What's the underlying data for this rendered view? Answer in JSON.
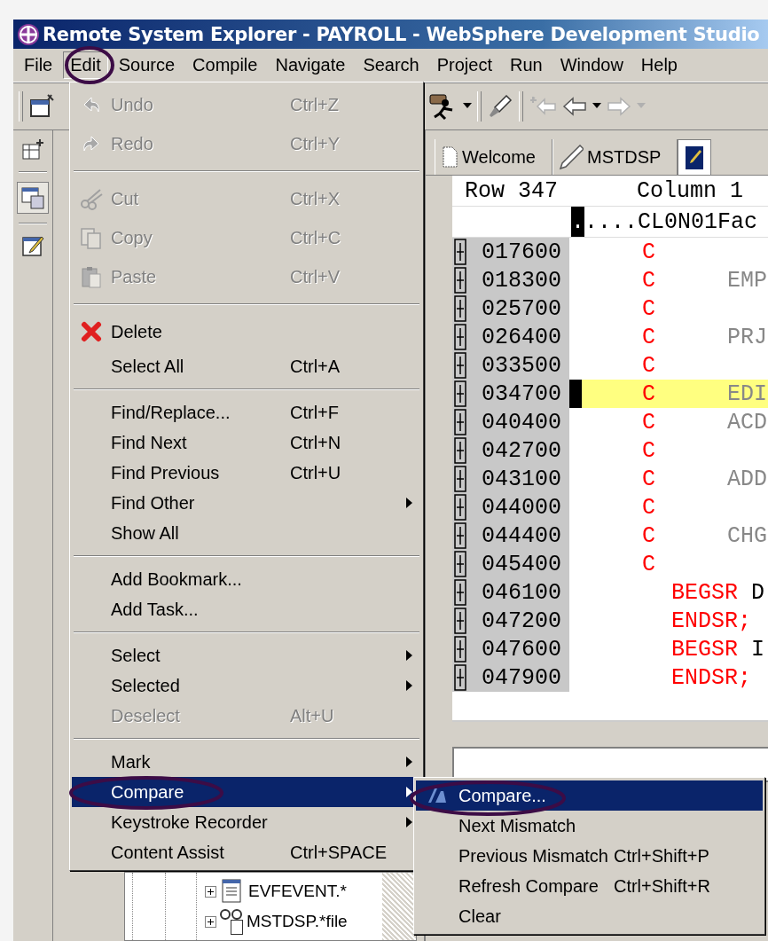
{
  "window": {
    "title": "Remote System Explorer - PAYROLL - WebSphere Development Studio"
  },
  "menu_bar": [
    {
      "label": "File",
      "selected": false
    },
    {
      "label": "Edit",
      "selected": true
    },
    {
      "label": "Source",
      "selected": false
    },
    {
      "label": "Compile",
      "selected": false
    },
    {
      "label": "Navigate",
      "selected": false
    },
    {
      "label": "Search",
      "selected": false
    },
    {
      "label": "Project",
      "selected": false
    },
    {
      "label": "Run",
      "selected": false
    },
    {
      "label": "Window",
      "selected": false
    },
    {
      "label": "Help",
      "selected": false
    }
  ],
  "edit_menu": {
    "items": [
      {
        "kind": "undo",
        "label": "Undo",
        "shortcut": "Ctrl+Z",
        "disabled": true,
        "submenu": false,
        "selected": false
      },
      {
        "kind": "redo",
        "label": "Redo",
        "shortcut": "Ctrl+Y",
        "disabled": true,
        "submenu": false,
        "selected": false
      },
      {
        "kind": "separator"
      },
      {
        "kind": "cut",
        "label": "Cut",
        "shortcut": "Ctrl+X",
        "disabled": true,
        "submenu": false,
        "selected": false
      },
      {
        "kind": "copy",
        "label": "Copy",
        "shortcut": "Ctrl+C",
        "disabled": true,
        "submenu": false,
        "selected": false
      },
      {
        "kind": "paste",
        "label": "Paste",
        "shortcut": "Ctrl+V",
        "disabled": true,
        "submenu": false,
        "selected": false
      },
      {
        "kind": "separator"
      },
      {
        "kind": "delete",
        "label": "Delete",
        "disabled": false,
        "submenu": false,
        "selected": false
      },
      {
        "kind": "item",
        "label": "Select All",
        "shortcut": "Ctrl+A",
        "disabled": false,
        "submenu": false,
        "selected": false
      },
      {
        "kind": "separator"
      },
      {
        "kind": "item",
        "label": "Find/Replace...",
        "shortcut": "Ctrl+F",
        "disabled": false,
        "submenu": false,
        "selected": false
      },
      {
        "kind": "item",
        "label": "Find Next",
        "shortcut": "Ctrl+N",
        "disabled": false,
        "submenu": false,
        "selected": false
      },
      {
        "kind": "item",
        "label": "Find Previous",
        "shortcut": "Ctrl+U",
        "disabled": false,
        "submenu": false,
        "selected": false
      },
      {
        "kind": "item",
        "label": "Find Other",
        "disabled": false,
        "submenu": true,
        "selected": false
      },
      {
        "kind": "item",
        "label": "Show All",
        "disabled": false,
        "submenu": false,
        "selected": false
      },
      {
        "kind": "separator"
      },
      {
        "kind": "item",
        "label": "Add Bookmark...",
        "disabled": false,
        "submenu": false,
        "selected": false
      },
      {
        "kind": "item",
        "label": "Add Task...",
        "disabled": false,
        "submenu": false,
        "selected": false
      },
      {
        "kind": "separator"
      },
      {
        "kind": "item",
        "label": "Select",
        "disabled": false,
        "submenu": true,
        "selected": false
      },
      {
        "kind": "item",
        "label": "Selected",
        "disabled": false,
        "submenu": true,
        "selected": false
      },
      {
        "kind": "item",
        "label": "Deselect",
        "shortcut": "Alt+U",
        "disabled": true,
        "submenu": false,
        "selected": false
      },
      {
        "kind": "separator"
      },
      {
        "kind": "item",
        "label": "Mark",
        "disabled": false,
        "submenu": true,
        "selected": false
      },
      {
        "kind": "item",
        "label": "Compare",
        "disabled": false,
        "submenu": true,
        "selected": true
      },
      {
        "kind": "item",
        "label": "Keystroke Recorder",
        "disabled": false,
        "submenu": true,
        "selected": false
      },
      {
        "kind": "item",
        "label": "Content Assist",
        "shortcut": "Ctrl+SPACE",
        "disabled": false,
        "submenu": false,
        "selected": false
      }
    ]
  },
  "compare_submenu": {
    "items": [
      {
        "kind": "compare",
        "label": "Compare...",
        "disabled": false,
        "submenu": false,
        "selected": true
      },
      {
        "kind": "item",
        "label": "Next Mismatch",
        "disabled": false,
        "submenu": false,
        "selected": false
      },
      {
        "kind": "item",
        "label": "Previous Mismatch",
        "shortcut": "Ctrl+Shift+P",
        "disabled": false,
        "submenu": false,
        "selected": false
      },
      {
        "kind": "item",
        "label": "Refresh Compare",
        "shortcut": "Ctrl+Shift+R",
        "disabled": false,
        "submenu": false,
        "selected": false
      },
      {
        "kind": "item",
        "label": "Clear",
        "disabled": false,
        "submenu": false,
        "selected": false
      }
    ]
  },
  "editor": {
    "tabs": [
      {
        "label": "Welcome",
        "kind": "page",
        "selected": false
      },
      {
        "label": "MSTDSP",
        "kind": "pencil",
        "selected": false
      },
      {
        "kind": "edit",
        "selected": true
      }
    ],
    "position": {
      "row": "Row 347",
      "column": "Column 1"
    },
    "ruler": {
      "cursor": ".",
      "text": "....CL0N01Fac"
    },
    "lines": [
      {
        "number": "017600",
        "kind": "spec",
        "spec": "C",
        "selected": false
      },
      {
        "number": "018300",
        "kind": "spec",
        "spec": "C",
        "text": "EMP",
        "selected": false
      },
      {
        "number": "025700",
        "kind": "spec",
        "spec": "C",
        "selected": false
      },
      {
        "number": "026400",
        "kind": "spec",
        "spec": "C",
        "text": "PRJ",
        "selected": false
      },
      {
        "number": "033500",
        "kind": "spec",
        "spec": "C",
        "selected": false
      },
      {
        "number": "034700",
        "kind": "spec",
        "spec": "C",
        "text": "EDI",
        "selected": true
      },
      {
        "number": "040400",
        "kind": "spec",
        "spec": "C",
        "text": "ACD",
        "selected": false
      },
      {
        "number": "042700",
        "kind": "spec",
        "spec": "C",
        "selected": false
      },
      {
        "number": "043100",
        "kind": "spec",
        "spec": "C",
        "text": "ADD",
        "selected": false
      },
      {
        "number": "044000",
        "kind": "spec",
        "spec": "C",
        "selected": false
      },
      {
        "number": "044400",
        "kind": "spec",
        "spec": "C",
        "text": "CHG",
        "selected": false
      },
      {
        "number": "045400",
        "kind": "spec",
        "spec": "C",
        "selected": false
      },
      {
        "number": "046100",
        "kind": "free",
        "keyword": "BEGSR",
        "text": "D",
        "selected": false
      },
      {
        "number": "047200",
        "kind": "free",
        "keyword": "ENDSR;",
        "selected": false
      },
      {
        "number": "047600",
        "kind": "free",
        "keyword": "BEGSR",
        "text": "I",
        "selected": false
      },
      {
        "number": "047900",
        "kind": "free",
        "keyword": "ENDSR;",
        "selected": false
      }
    ]
  },
  "tree": {
    "items": [
      {
        "label": "EVFEVENT.*",
        "kind": "display",
        "expanded": false
      },
      {
        "label": "MSTDSP.*file",
        "kind": "glasses",
        "expanded": false
      }
    ]
  }
}
